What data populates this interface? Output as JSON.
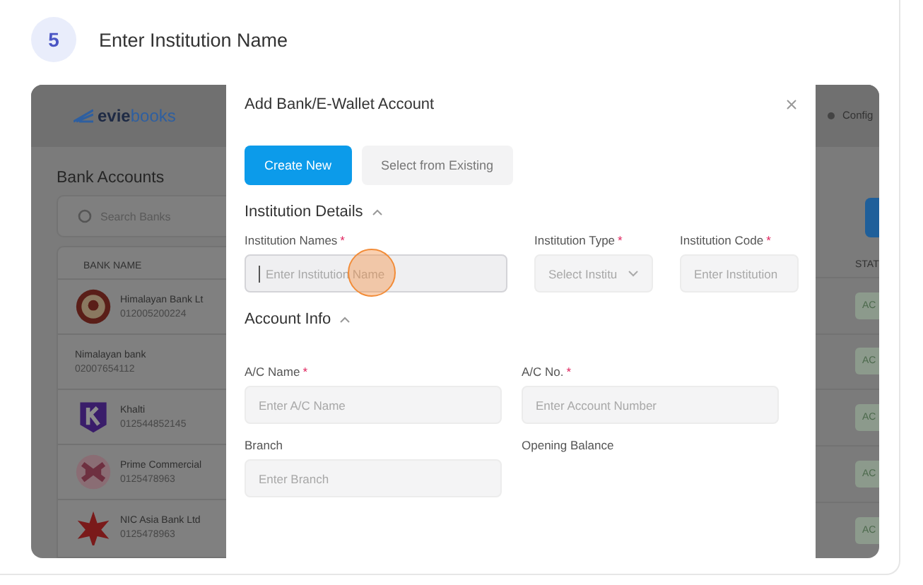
{
  "step": {
    "number": "5",
    "title": "Enter Institution Name"
  },
  "app": {
    "logo": {
      "first": "evie",
      "second": "books"
    },
    "header_link": "Config",
    "page_title": "Bank Accounts",
    "search": {
      "placeholder": "Search Banks"
    },
    "columns": [
      "BANK NAME",
      "STAT"
    ],
    "rows": [
      {
        "kind": "seal",
        "name": "Himalayan Bank Lt",
        "number": "012005200224",
        "status": "AC"
      },
      {
        "kind": "plain",
        "name": "Nimalayan bank",
        "number": "02007654112",
        "status": "AC"
      },
      {
        "kind": "letter",
        "name": "Khalti",
        "number": "012544852145",
        "status": "AC"
      },
      {
        "kind": "knot",
        "name": "Prime Commercial",
        "number": "0125478963",
        "status": "AC"
      },
      {
        "kind": "star",
        "name": "NIC Asia Bank Ltd",
        "number": "0125478963",
        "status": "AC"
      }
    ]
  },
  "modal": {
    "title": "Add Bank/E-Wallet Account",
    "tabs": [
      {
        "label": "Create New",
        "selected": true
      },
      {
        "label": "Select from Existing",
        "selected": false
      }
    ],
    "sections": [
      {
        "title": "Institution Details",
        "expanded": true,
        "fields": [
          {
            "kind": "text",
            "label": "Institution Names",
            "required_mark": "*",
            "placeholder": "Enter Institution Name",
            "focused": true
          },
          {
            "kind": "select",
            "label": "Institution Type",
            "required_mark": "*",
            "placeholder": "Select Institu",
            "focused": false
          },
          {
            "kind": "text",
            "label": "Institution Code",
            "required_mark": "*",
            "placeholder": "Enter Institution",
            "focused": false
          }
        ]
      },
      {
        "title": "Account Info",
        "expanded": true,
        "fields": [
          {
            "kind": "text",
            "label": "A/C Name",
            "required_mark": "*",
            "placeholder": "Enter A/C Name",
            "focused": false
          },
          {
            "kind": "text",
            "label": "A/C No.",
            "required_mark": "*",
            "placeholder": "Enter Account Number",
            "focused": false
          },
          {
            "kind": "text",
            "label": "Branch",
            "placeholder": "Enter Branch",
            "focused": false
          },
          {
            "kind": "label",
            "label": "Opening Balance"
          }
        ]
      }
    ]
  }
}
